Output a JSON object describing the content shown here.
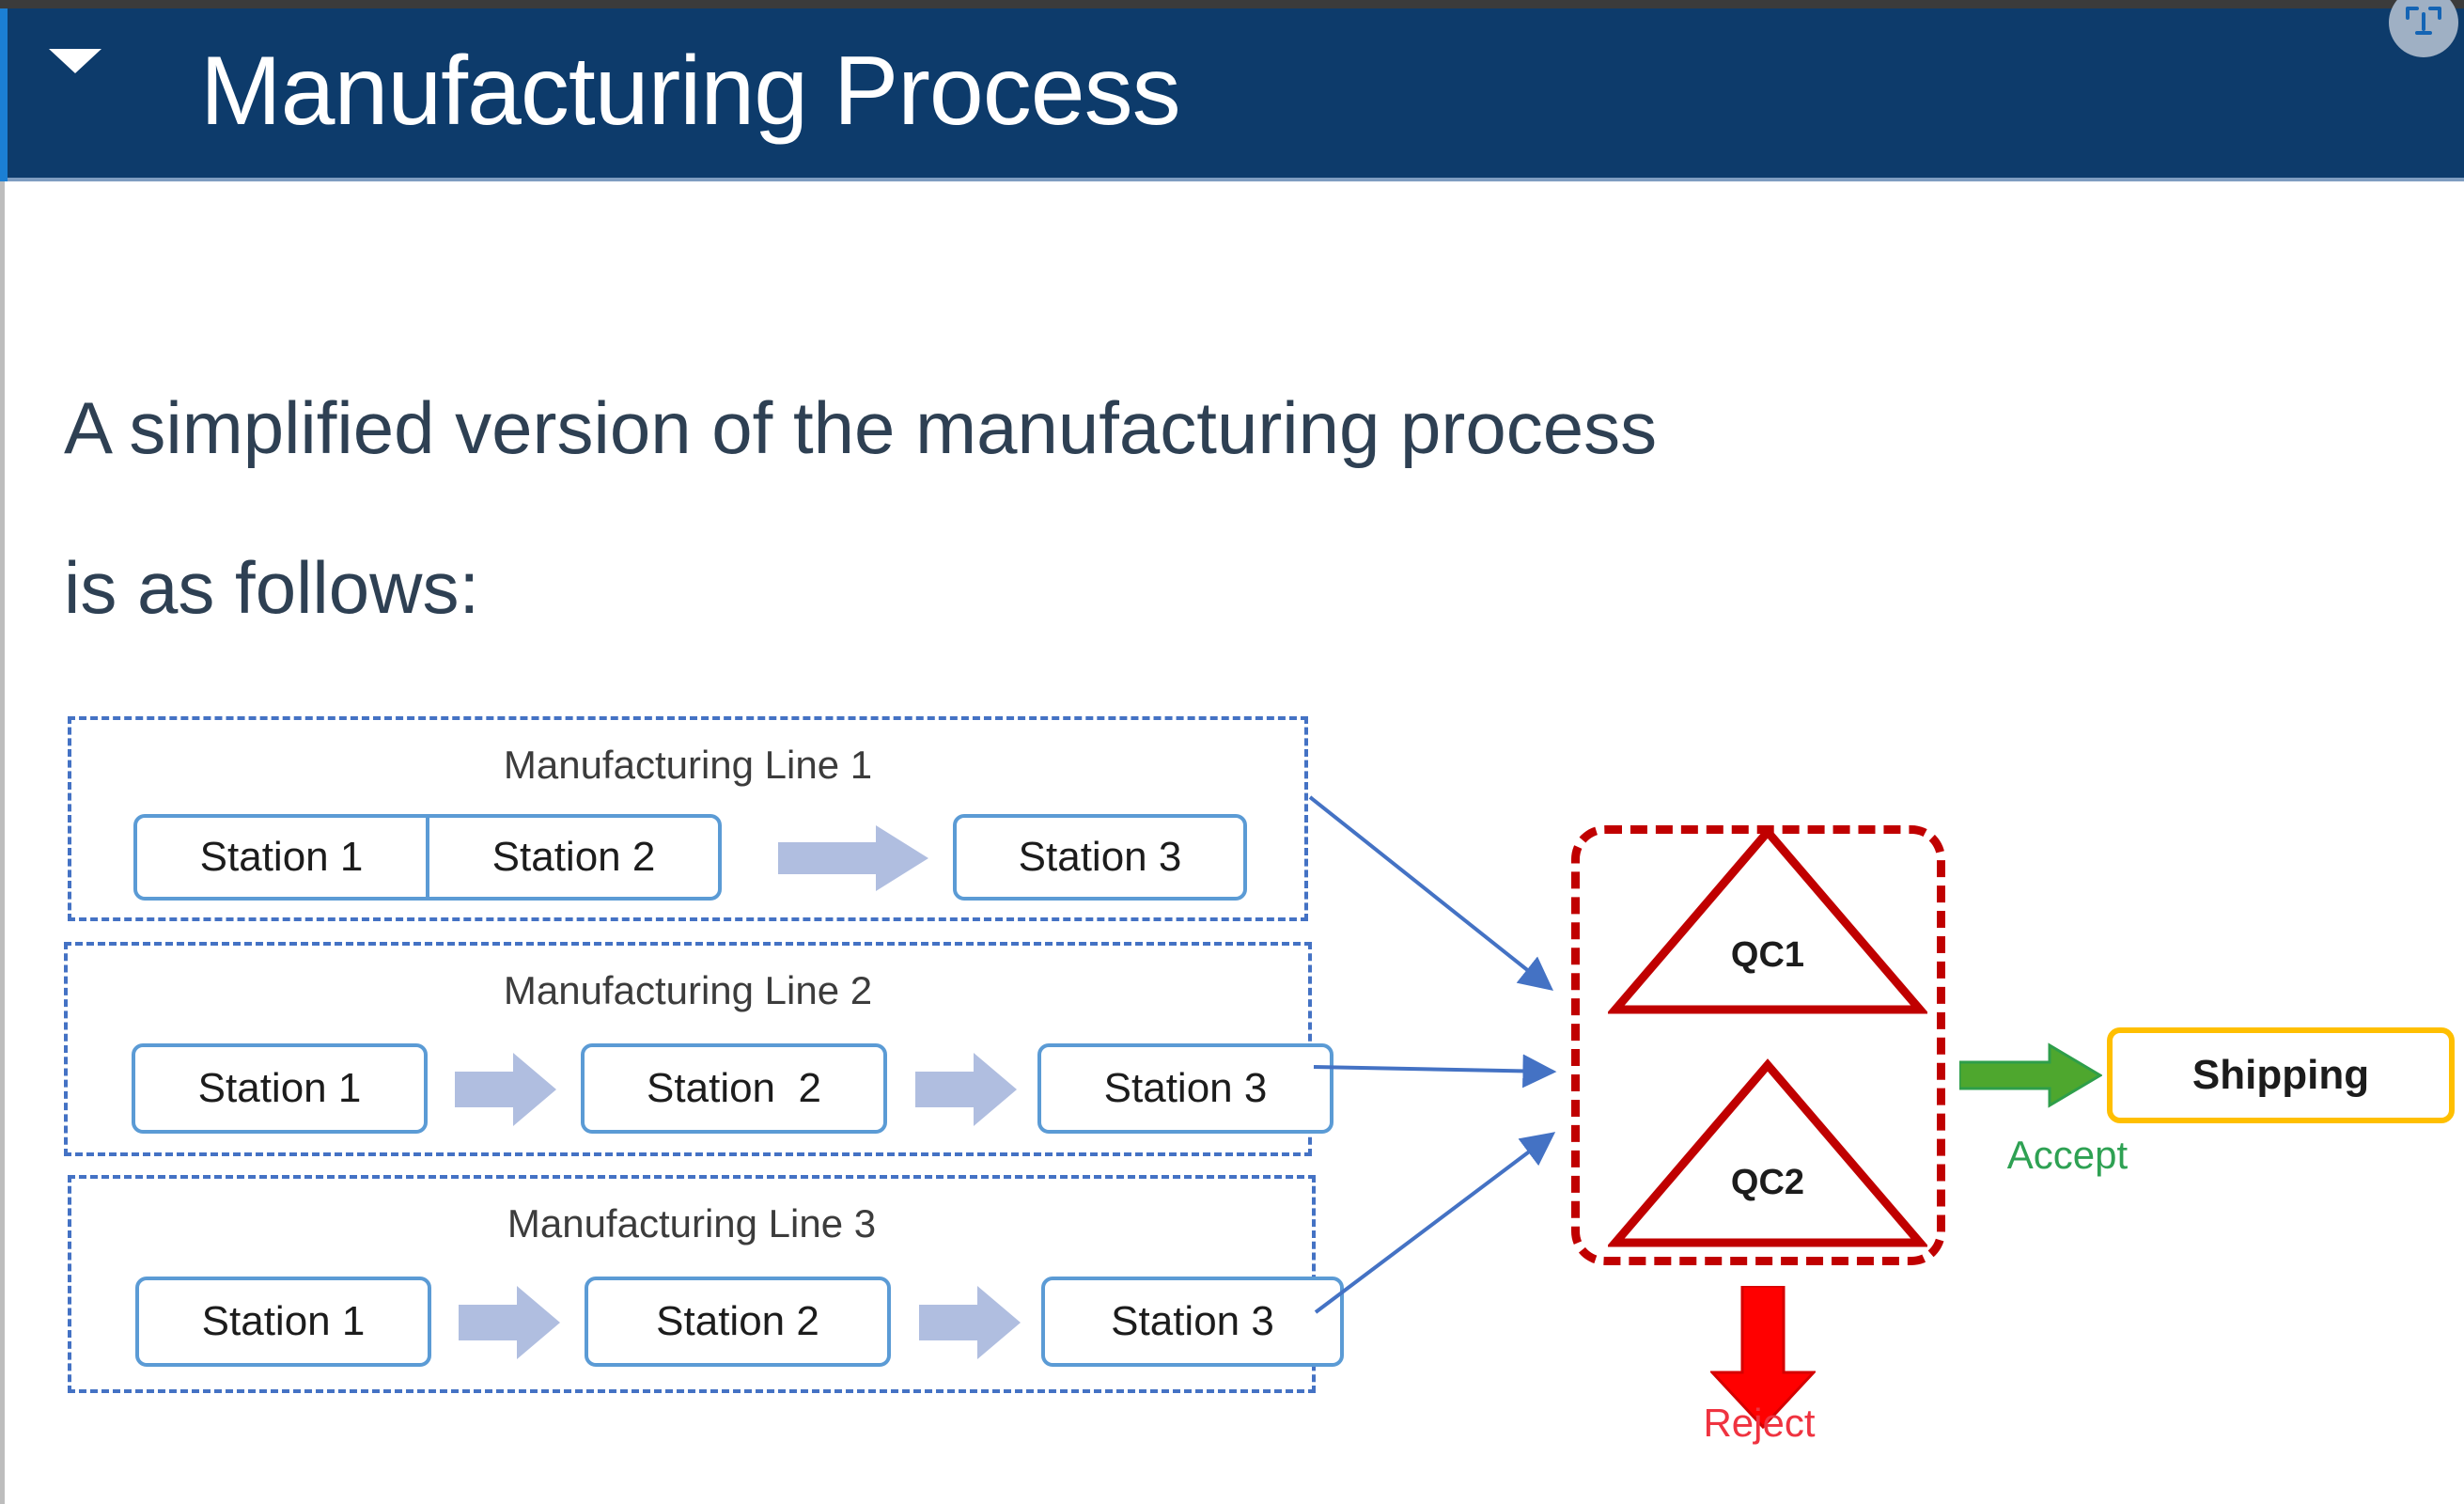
{
  "header": {
    "title": "Manufacturing Process",
    "collapse_icon": "caret-down-icon",
    "corner_icon": "cursor-badge-icon",
    "band_color": "#0d3b6b"
  },
  "body": {
    "intro_line_1": "A simplified version of the manufacturing process",
    "intro_line_2": "is as follows:",
    "text_color": "#2e4053"
  },
  "diagram": {
    "lines": [
      {
        "title": "Manufacturing Line 1",
        "stations": [
          "Station 1",
          "Station 2",
          "Station 3"
        ],
        "arrows": 1,
        "border_color": "#4472c4"
      },
      {
        "title": "Manufacturing Line 2",
        "stations": [
          "Station 1",
          "Station  2",
          "Station 3"
        ],
        "arrows": 2,
        "border_color": "#4472c4"
      },
      {
        "title": "Manufacturing Line 3",
        "stations": [
          "Station 1",
          "Station 2",
          "Station 3"
        ],
        "arrows": 2,
        "border_color": "#4472c4"
      }
    ],
    "quality_control": {
      "border_color": "#c00000",
      "gates": [
        "QC1",
        "QC2"
      ]
    },
    "outputs": {
      "accept_label": "Accept",
      "accept_color": "#2ea153",
      "shipping_label": "Shipping",
      "shipping_border_color": "#ffbf00",
      "reject_label": "Reject",
      "reject_color": "#ef3340"
    },
    "station_border_color": "#5b9bd5",
    "flow_arrow_color": "#b0bee0",
    "connector_color": "#4472c4"
  }
}
